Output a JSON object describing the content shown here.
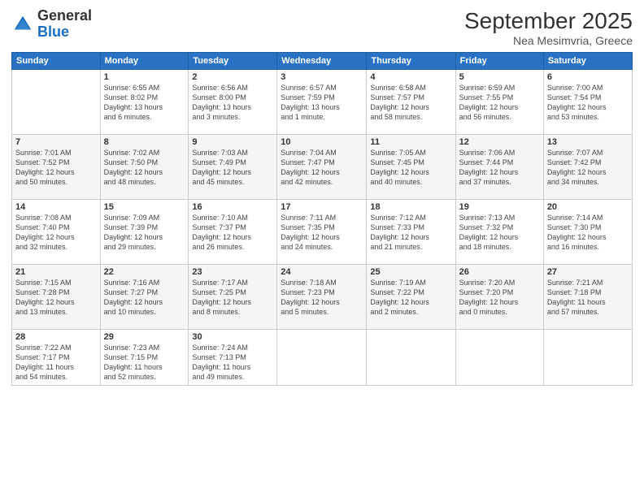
{
  "header": {
    "logo_general": "General",
    "logo_blue": "Blue",
    "month_year": "September 2025",
    "location": "Nea Mesimvria, Greece"
  },
  "days_of_week": [
    "Sunday",
    "Monday",
    "Tuesday",
    "Wednesday",
    "Thursday",
    "Friday",
    "Saturday"
  ],
  "weeks": [
    [
      {
        "day": "",
        "info": ""
      },
      {
        "day": "1",
        "info": "Sunrise: 6:55 AM\nSunset: 8:02 PM\nDaylight: 13 hours\nand 6 minutes."
      },
      {
        "day": "2",
        "info": "Sunrise: 6:56 AM\nSunset: 8:00 PM\nDaylight: 13 hours\nand 3 minutes."
      },
      {
        "day": "3",
        "info": "Sunrise: 6:57 AM\nSunset: 7:59 PM\nDaylight: 13 hours\nand 1 minute."
      },
      {
        "day": "4",
        "info": "Sunrise: 6:58 AM\nSunset: 7:57 PM\nDaylight: 12 hours\nand 58 minutes."
      },
      {
        "day": "5",
        "info": "Sunrise: 6:59 AM\nSunset: 7:55 PM\nDaylight: 12 hours\nand 56 minutes."
      },
      {
        "day": "6",
        "info": "Sunrise: 7:00 AM\nSunset: 7:54 PM\nDaylight: 12 hours\nand 53 minutes."
      }
    ],
    [
      {
        "day": "7",
        "info": "Sunrise: 7:01 AM\nSunset: 7:52 PM\nDaylight: 12 hours\nand 50 minutes."
      },
      {
        "day": "8",
        "info": "Sunrise: 7:02 AM\nSunset: 7:50 PM\nDaylight: 12 hours\nand 48 minutes."
      },
      {
        "day": "9",
        "info": "Sunrise: 7:03 AM\nSunset: 7:49 PM\nDaylight: 12 hours\nand 45 minutes."
      },
      {
        "day": "10",
        "info": "Sunrise: 7:04 AM\nSunset: 7:47 PM\nDaylight: 12 hours\nand 42 minutes."
      },
      {
        "day": "11",
        "info": "Sunrise: 7:05 AM\nSunset: 7:45 PM\nDaylight: 12 hours\nand 40 minutes."
      },
      {
        "day": "12",
        "info": "Sunrise: 7:06 AM\nSunset: 7:44 PM\nDaylight: 12 hours\nand 37 minutes."
      },
      {
        "day": "13",
        "info": "Sunrise: 7:07 AM\nSunset: 7:42 PM\nDaylight: 12 hours\nand 34 minutes."
      }
    ],
    [
      {
        "day": "14",
        "info": "Sunrise: 7:08 AM\nSunset: 7:40 PM\nDaylight: 12 hours\nand 32 minutes."
      },
      {
        "day": "15",
        "info": "Sunrise: 7:09 AM\nSunset: 7:39 PM\nDaylight: 12 hours\nand 29 minutes."
      },
      {
        "day": "16",
        "info": "Sunrise: 7:10 AM\nSunset: 7:37 PM\nDaylight: 12 hours\nand 26 minutes."
      },
      {
        "day": "17",
        "info": "Sunrise: 7:11 AM\nSunset: 7:35 PM\nDaylight: 12 hours\nand 24 minutes."
      },
      {
        "day": "18",
        "info": "Sunrise: 7:12 AM\nSunset: 7:33 PM\nDaylight: 12 hours\nand 21 minutes."
      },
      {
        "day": "19",
        "info": "Sunrise: 7:13 AM\nSunset: 7:32 PM\nDaylight: 12 hours\nand 18 minutes."
      },
      {
        "day": "20",
        "info": "Sunrise: 7:14 AM\nSunset: 7:30 PM\nDaylight: 12 hours\nand 16 minutes."
      }
    ],
    [
      {
        "day": "21",
        "info": "Sunrise: 7:15 AM\nSunset: 7:28 PM\nDaylight: 12 hours\nand 13 minutes."
      },
      {
        "day": "22",
        "info": "Sunrise: 7:16 AM\nSunset: 7:27 PM\nDaylight: 12 hours\nand 10 minutes."
      },
      {
        "day": "23",
        "info": "Sunrise: 7:17 AM\nSunset: 7:25 PM\nDaylight: 12 hours\nand 8 minutes."
      },
      {
        "day": "24",
        "info": "Sunrise: 7:18 AM\nSunset: 7:23 PM\nDaylight: 12 hours\nand 5 minutes."
      },
      {
        "day": "25",
        "info": "Sunrise: 7:19 AM\nSunset: 7:22 PM\nDaylight: 12 hours\nand 2 minutes."
      },
      {
        "day": "26",
        "info": "Sunrise: 7:20 AM\nSunset: 7:20 PM\nDaylight: 12 hours\nand 0 minutes."
      },
      {
        "day": "27",
        "info": "Sunrise: 7:21 AM\nSunset: 7:18 PM\nDaylight: 11 hours\nand 57 minutes."
      }
    ],
    [
      {
        "day": "28",
        "info": "Sunrise: 7:22 AM\nSunset: 7:17 PM\nDaylight: 11 hours\nand 54 minutes."
      },
      {
        "day": "29",
        "info": "Sunrise: 7:23 AM\nSunset: 7:15 PM\nDaylight: 11 hours\nand 52 minutes."
      },
      {
        "day": "30",
        "info": "Sunrise: 7:24 AM\nSunset: 7:13 PM\nDaylight: 11 hours\nand 49 minutes."
      },
      {
        "day": "",
        "info": ""
      },
      {
        "day": "",
        "info": ""
      },
      {
        "day": "",
        "info": ""
      },
      {
        "day": "",
        "info": ""
      }
    ]
  ]
}
